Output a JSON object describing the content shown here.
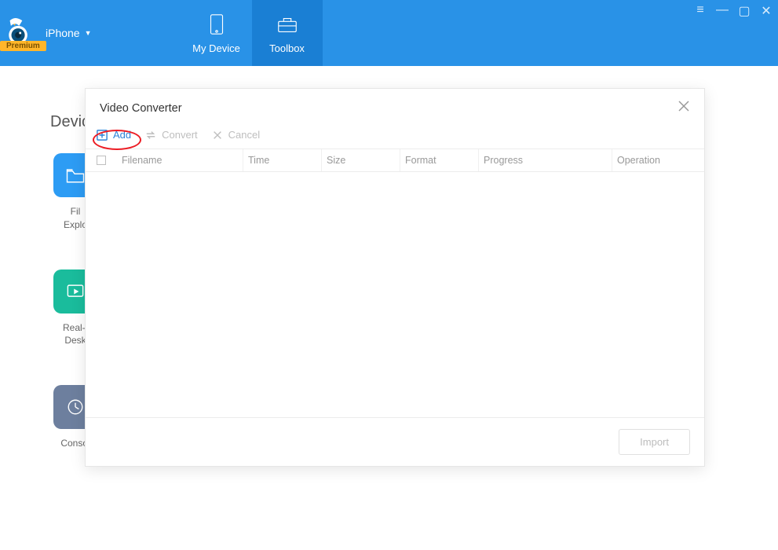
{
  "header": {
    "device_label": "iPhone",
    "premium_label": "Premium",
    "tabs": {
      "my_device": "My Device",
      "toolbox": "Toolbox"
    }
  },
  "bg": {
    "section_title": "Devic",
    "tiles": {
      "file": "Fil\nExplo",
      "realtime": "Real-t\nDesk",
      "console": "Consol"
    }
  },
  "modal": {
    "title": "Video Converter",
    "actions": {
      "add": "Add",
      "convert": "Convert",
      "cancel": "Cancel"
    },
    "columns": {
      "filename": "Filename",
      "time": "Time",
      "size": "Size",
      "format": "Format",
      "progress": "Progress",
      "operation": "Operation"
    },
    "import_label": "Import"
  }
}
